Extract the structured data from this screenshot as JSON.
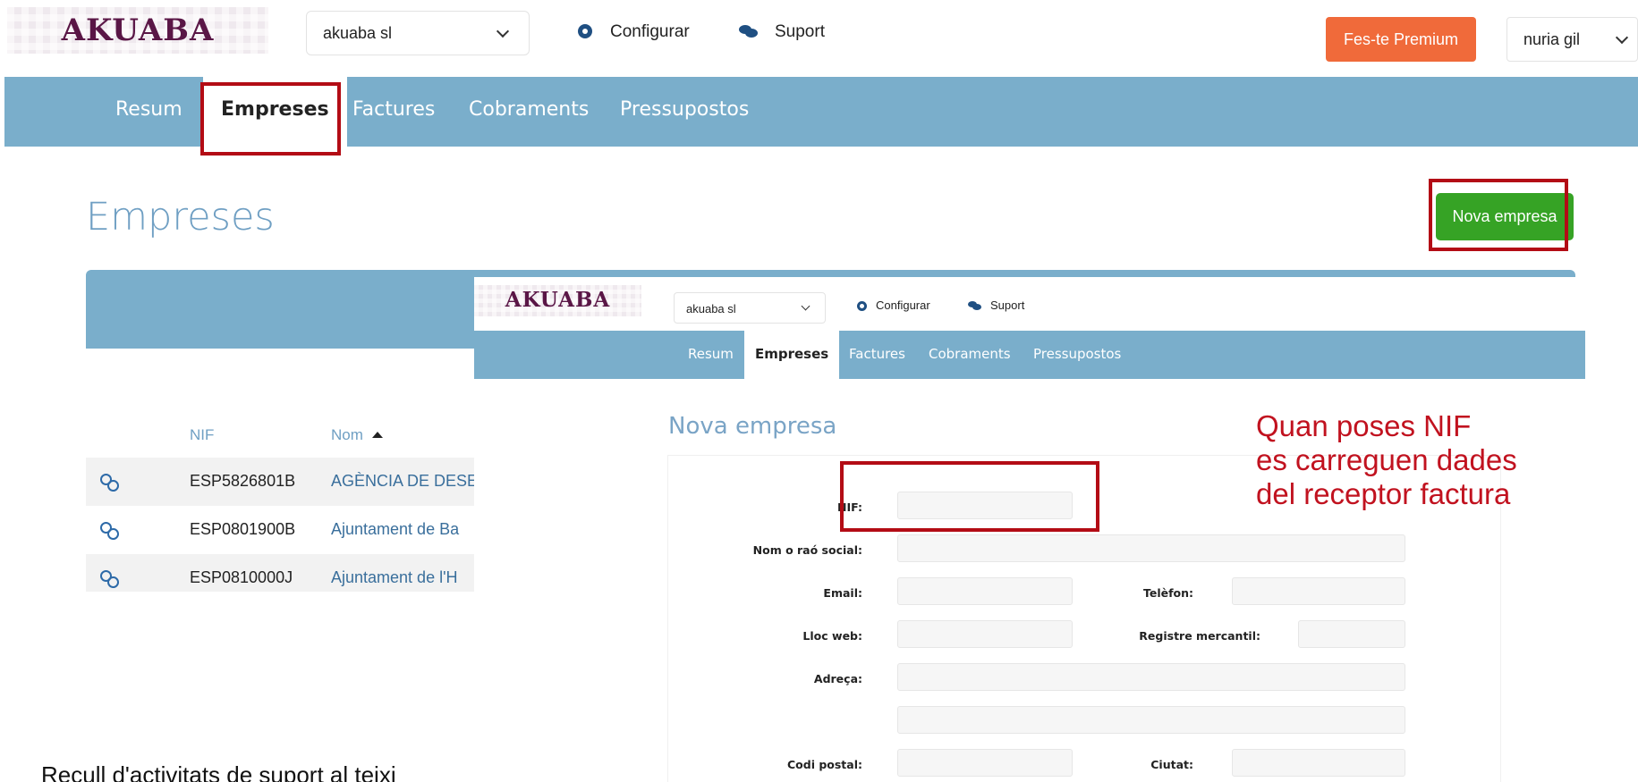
{
  "background": {
    "logo": "AKUABA",
    "company_select": "akuaba sl",
    "nav_configure": "Configurar",
    "nav_support": "Suport",
    "premium_button": "Fes-te Premium",
    "user_select": "nuria gil",
    "tabs": [
      "Resum",
      "Empreses",
      "Factures",
      "Cobraments",
      "Pressupostos"
    ],
    "page_title": "Empreses",
    "new_company_button": "Nova empresa",
    "columns": {
      "nif": "NIF",
      "nom": "Nom"
    },
    "rows": [
      {
        "nif": "ESP5826801B",
        "nom": "AGÈNCIA DE DESE"
      },
      {
        "nif": "ESP0801900B",
        "nom": "Ajuntament de Ba"
      },
      {
        "nif": "ESP0810000J",
        "nom": "Ajuntament de l'H"
      }
    ],
    "caption": "Recull d'activitats de suport al teixi"
  },
  "overlay": {
    "logo": "AKUABA",
    "company_select": "akuaba sl",
    "nav_configure": "Configurar",
    "nav_support": "Suport",
    "tabs": [
      "Resum",
      "Empreses",
      "Factures",
      "Cobraments",
      "Pressupostos"
    ],
    "page_title": "Nova empresa",
    "form": {
      "nif": "NIF:",
      "nom": "Nom o raó social:",
      "email": "Email:",
      "telefon": "Telèfon:",
      "lloc_web": "Lloc web:",
      "registre": "Registre mercantil:",
      "adreca": "Adreça:",
      "codi_postal": "Codi postal:",
      "ciutat": "Ciutat:"
    }
  },
  "annotation": "Quan poses NIF\nes carreguen dades\ndel receptor factura",
  "colors": {
    "navbar": "#7aaecb",
    "premium": "#f06a3a",
    "green": "#36a325",
    "highlight_red": "#b30c15",
    "logo_text": "#5a1646"
  }
}
